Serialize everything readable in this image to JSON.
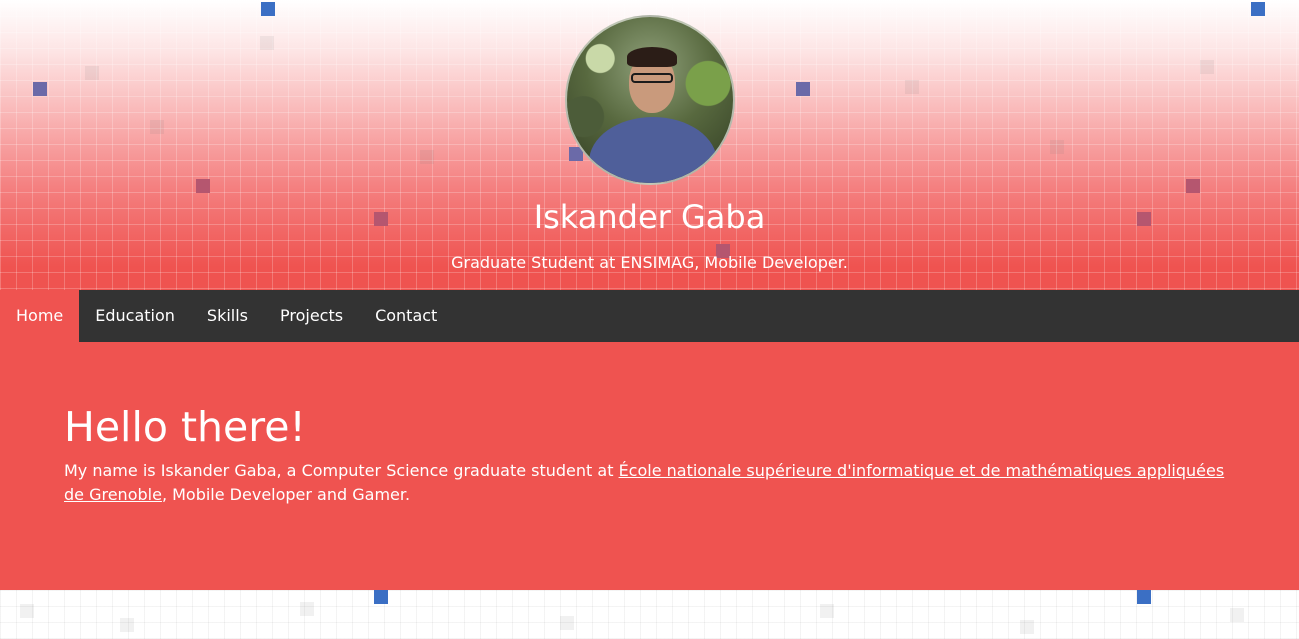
{
  "header": {
    "name": "Iskander Gaba",
    "tagline": "Graduate Student at ENSIMAG, Mobile Developer."
  },
  "nav": {
    "items": [
      {
        "label": "Home",
        "active": true
      },
      {
        "label": "Education"
      },
      {
        "label": "Skills"
      },
      {
        "label": "Projects"
      },
      {
        "label": "Contact"
      }
    ]
  },
  "main": {
    "heading": "Hello there!",
    "intro_before": "My name is Iskander Gaba, a Computer Science graduate student at ",
    "school_link": "École nationale supérieure d'informatique et de mathématiques appliquées de Grenoble",
    "intro_after": ", Mobile Developer and Gamer."
  },
  "colors": {
    "accent": "#ef5350",
    "nav_bg": "#333333",
    "text": "#ffffff"
  }
}
